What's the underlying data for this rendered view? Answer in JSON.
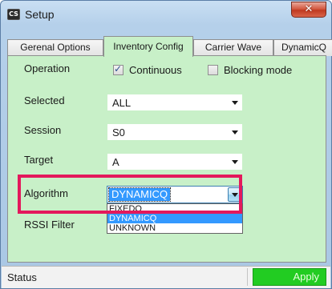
{
  "window": {
    "title": "Setup",
    "app_icon_text": "CS",
    "close_glyph": "✕"
  },
  "tabs": [
    {
      "label": "Gerenal Options",
      "active": false
    },
    {
      "label": "Inventory Config",
      "active": true
    },
    {
      "label": "Carrier Wave",
      "active": false
    },
    {
      "label": "DynamicQ",
      "active": false
    }
  ],
  "operation": {
    "label": "Operation",
    "continuous": {
      "label": "Continuous",
      "checked": true
    },
    "blocking_mode": {
      "label": "Blocking mode",
      "checked": false
    }
  },
  "selected": {
    "label": "Selected",
    "value": "ALL"
  },
  "session": {
    "label": "Session",
    "value": "S0"
  },
  "target": {
    "label": "Target",
    "value": "A"
  },
  "algorithm": {
    "label": "Algorithm",
    "value": "DYNAMICQ",
    "options": [
      "FIXEDQ",
      "DYNAMICQ",
      "UNKNOWN"
    ],
    "highlighted_option": "DYNAMICQ"
  },
  "rssi_filter": {
    "label": "RSSI Filter"
  },
  "status": {
    "label": "Status",
    "apply_label": "Apply"
  },
  "colors": {
    "panel_bg": "#c8f0c8",
    "highlight_border": "#e3195c",
    "apply_bg": "#22cc22",
    "selection_blue": "#3399ff"
  }
}
